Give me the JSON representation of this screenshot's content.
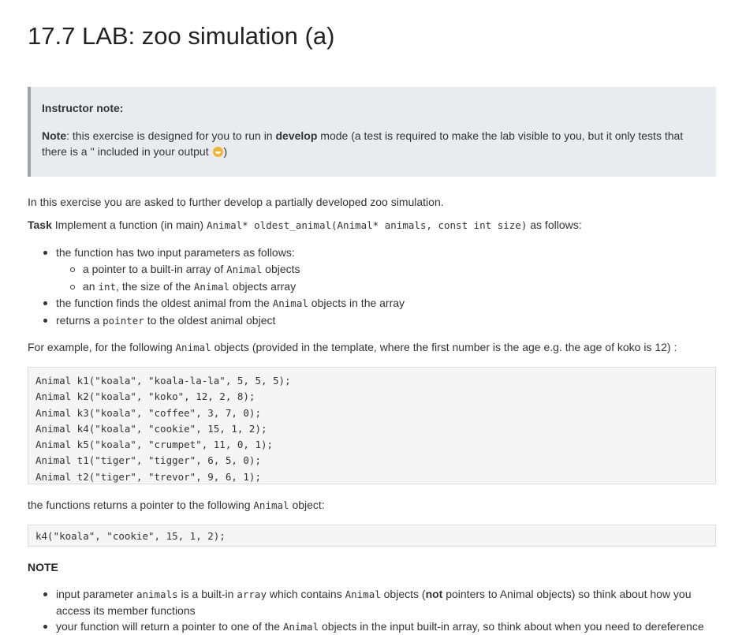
{
  "title": "17.7 LAB: zoo simulation (a)",
  "instructor_note": {
    "heading": "Instructor note:",
    "note_label": "Note",
    "text_1": ": this exercise is designed for you to run in ",
    "develop": "develop",
    "text_2": " mode (a test is required to make the lab visible to you, but it only tests that there is a '' included in your output ",
    "text_3": ")"
  },
  "intro": "In this exercise you are asked to further develop a partially developed zoo simulation.",
  "task": {
    "label": "Task",
    "text_1": " Implement a function (in main) ",
    "signature": "Animal* oldest_animal(Animal* animals, const int size)",
    "text_2": " as follows:"
  },
  "task_list": {
    "item1": "the function has two input parameters as follows:",
    "sub1_a": "a pointer to a built-in array of ",
    "sub1_code": "Animal",
    "sub1_b": " objects",
    "sub2_a": "an ",
    "sub2_code1": "int",
    "sub2_b": ", the size of the ",
    "sub2_code2": "Animal",
    "sub2_c": " objects array",
    "item2_a": "the function finds the oldest animal from the ",
    "item2_code": "Animal",
    "item2_b": " objects in the array",
    "item3_a": "returns a ",
    "item3_code": "pointer",
    "item3_b": " to the oldest animal object"
  },
  "example": {
    "text_1": "For example, for the following ",
    "code": "Animal",
    "text_2": " objects (provided in the template, where the first number is the age e.g. the age of koko is 12) :"
  },
  "code_lines": [
    "Animal k1(\"koala\", \"koala-la-la\", 5, 5, 5);",
    "Animal k2(\"koala\", \"koko\", 12, 2, 8);",
    "Animal k3(\"koala\", \"coffee\", 3, 7, 0);",
    "Animal k4(\"koala\", \"cookie\", 15, 1, 2);",
    "Animal k5(\"koala\", \"crumpet\", 11, 0, 1);",
    "Animal t1(\"tiger\", \"tigger\", 6, 5, 0);",
    "Animal t2(\"tiger\", \"trevor\", 9, 6, 1);"
  ],
  "result": {
    "text_1": "the functions returns a pointer to the following ",
    "code": "Animal",
    "text_2": " object:"
  },
  "result_code": "k4(\"koala\", \"cookie\", 15, 1, 2);",
  "note_heading": "NOTE",
  "notes": {
    "n1_a": "input parameter ",
    "n1_code1": "animals",
    "n1_b": " is a built-in ",
    "n1_code2": "array",
    "n1_c": " which contains ",
    "n1_code3": "Animal",
    "n1_d": " objects (",
    "n1_not": "not",
    "n1_e": " pointers to Animal objects) so think about how you access its member functions",
    "n2_a": "your function will return a pointer to one of the ",
    "n2_code": "Animal",
    "n2_b": " objects in the input built-in array, so think about when you need to dereference"
  }
}
